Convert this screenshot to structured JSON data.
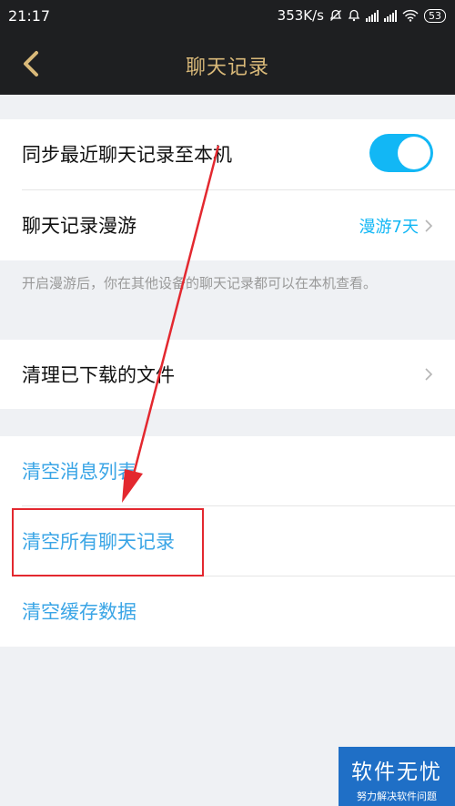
{
  "status_bar": {
    "time": "21:17",
    "speed": "353K/s",
    "battery": "53"
  },
  "header": {
    "title": "聊天记录"
  },
  "settings": {
    "sync_label": "同步最近聊天记录至本机",
    "roaming_label": "聊天记录漫游",
    "roaming_value": "漫游7天",
    "roaming_note": "开启漫游后，你在其他设备的聊天记录都可以在本机查看。",
    "clean_files_label": "清理已下载的文件"
  },
  "actions": {
    "clear_list": "清空消息列表",
    "clear_all_records": "清空所有聊天记录",
    "clear_cache": "清空缓存数据"
  },
  "watermark": {
    "title": "软件无忧",
    "subtitle": "努力解决软件问题"
  },
  "colors": {
    "accent": "#12b7f5",
    "link": "#3aa5e6",
    "header_bg": "#1e1f21",
    "title_gold": "#d9b979",
    "highlight": "#e3282f"
  }
}
